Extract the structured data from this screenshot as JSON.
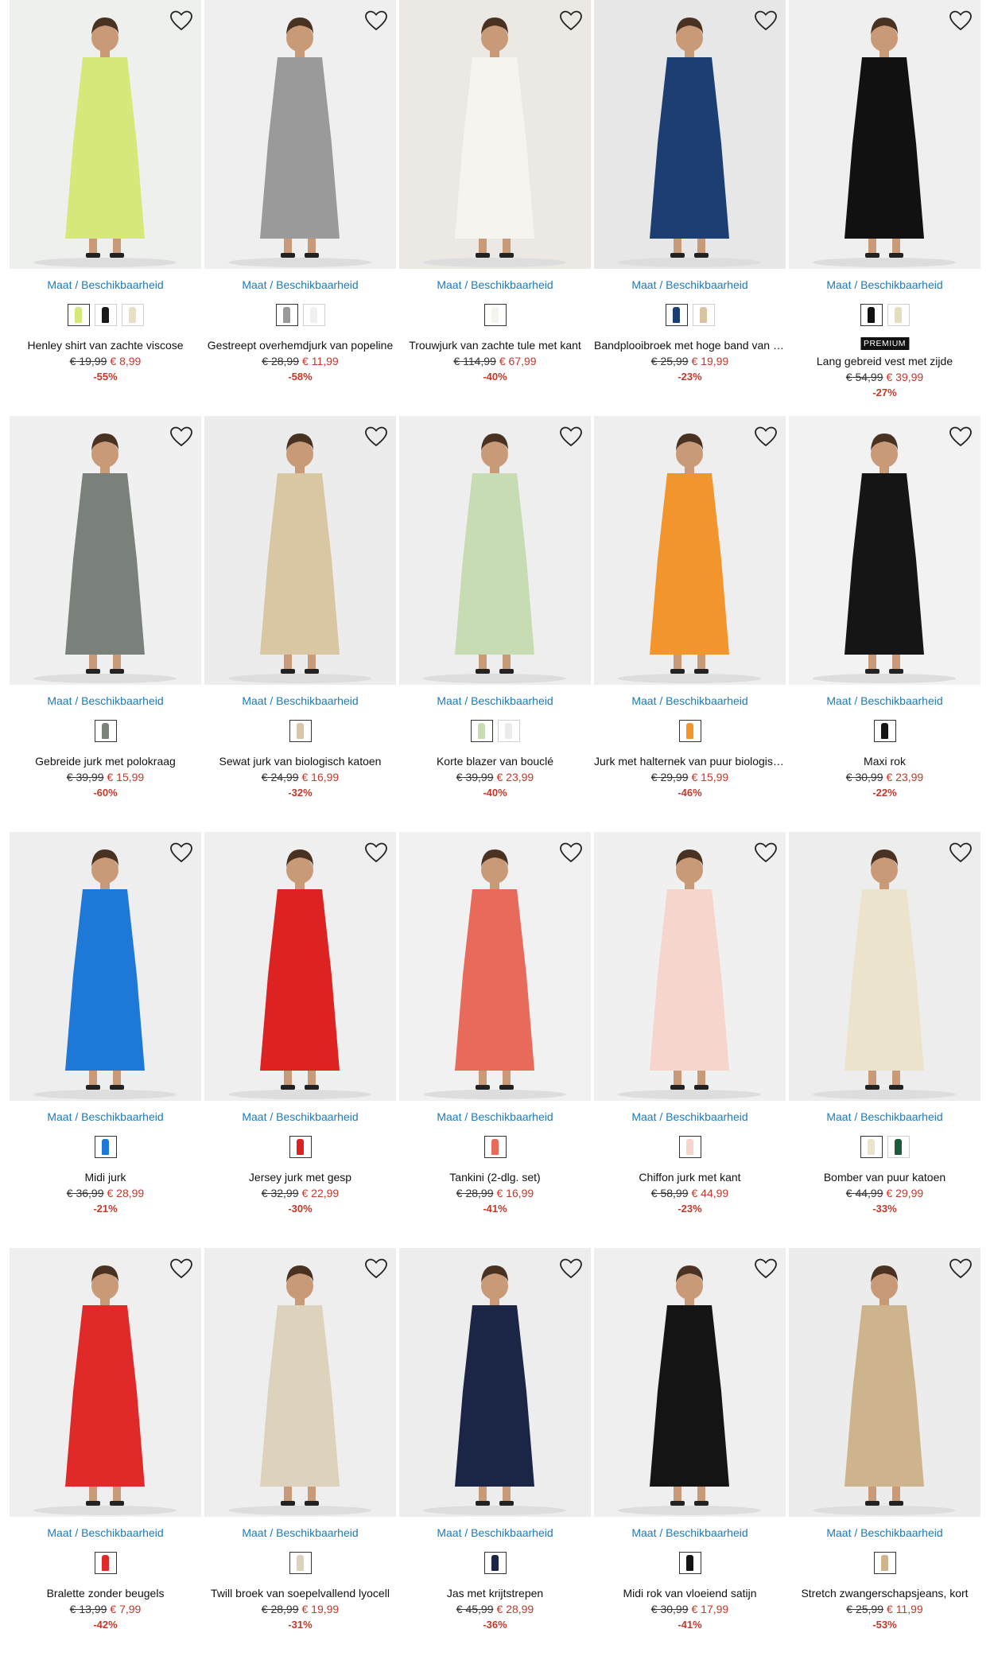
{
  "size_link_text": "Maat / Beschikbaarheid",
  "products": [
    {
      "name": "Henley shirt van zachte viscose",
      "old": "€ 19,99",
      "new": "€ 8,99",
      "disc": "-55%",
      "bg": "#eef0ee",
      "colors": [
        "#d7e87a",
        "#1a1a1a",
        "#e6e0c8"
      ],
      "badge": ""
    },
    {
      "name": "Gestreept overhemdjurk van popeline",
      "old": "€ 28,99",
      "new": "€ 11,99",
      "disc": "-58%",
      "bg": "#efefef",
      "colors": [
        "#9a9a9a",
        "#f0f0f0"
      ],
      "badge": ""
    },
    {
      "name": "Trouwjurk van zachte tule met kant",
      "old": "€ 114,99",
      "new": "€ 67,99",
      "disc": "-40%",
      "bg": "#ece9e4",
      "colors": [
        "#f6f4ef"
      ],
      "badge": ""
    },
    {
      "name": "Bandplooibroek met hoge band van crêpe",
      "old": "€ 25,99",
      "new": "€ 19,99",
      "disc": "-23%",
      "bg": "#e7e7e7",
      "colors": [
        "#1c3e73",
        "#d9c3a0"
      ],
      "badge": ""
    },
    {
      "name": "Lang gebreid vest met zijde",
      "old": "€ 54,99",
      "new": "€ 39,99",
      "disc": "-27%",
      "bg": "#efefef",
      "colors": [
        "#111111",
        "#e3dfbd"
      ],
      "badge": "PREMIUM"
    },
    {
      "name": "Gebreide jurk met polokraag",
      "old": "€ 39,99",
      "new": "€ 15,99",
      "disc": "-60%",
      "bg": "#f0f0f0",
      "colors": [
        "#7a807a"
      ],
      "badge": ""
    },
    {
      "name": "Sewat jurk van biologisch katoen",
      "old": "€ 24,99",
      "new": "€ 16,99",
      "disc": "-32%",
      "bg": "#ececec",
      "colors": [
        "#d9c7a4"
      ],
      "badge": ""
    },
    {
      "name": "Korte blazer van bouclé",
      "old": "€ 39,99",
      "new": "€ 23,99",
      "disc": "-40%",
      "bg": "#eeeeee",
      "colors": [
        "#c8dcb4",
        "#ebebeb"
      ],
      "badge": ""
    },
    {
      "name": "Jurk met halternek van puur biologisch katoen",
      "old": "€ 29,99",
      "new": "€ 15,99",
      "disc": "-46%",
      "bg": "#eeeeee",
      "colors": [
        "#f2952c"
      ],
      "badge": ""
    },
    {
      "name": "Maxi rok",
      "old": "€ 30,99",
      "new": "€ 23,99",
      "disc": "-22%",
      "bg": "#f2f2f2",
      "colors": [
        "#151515"
      ],
      "badge": ""
    },
    {
      "name": "Midi jurk",
      "old": "€ 36,99",
      "new": "€ 28,99",
      "disc": "-21%",
      "bg": "#eeeeee",
      "colors": [
        "#1e78d8"
      ],
      "badge": ""
    },
    {
      "name": "Jersey jurk met gesp",
      "old": "€ 32,99",
      "new": "€ 22,99",
      "disc": "-30%",
      "bg": "#efefef",
      "colors": [
        "#dd2222"
      ],
      "badge": ""
    },
    {
      "name": "Tankini (2-dlg. set)",
      "old": "€ 28,99",
      "new": "€ 16,99",
      "disc": "-41%",
      "bg": "#f1f1f1",
      "colors": [
        "#e86a5a"
      ],
      "badge": ""
    },
    {
      "name": "Chiffon jurk met kant",
      "old": "€ 58,99",
      "new": "€ 44,99",
      "disc": "-23%",
      "bg": "#f0f0f0",
      "colors": [
        "#f5d5cc"
      ],
      "badge": ""
    },
    {
      "name": "Bomber van puur katoen",
      "old": "€ 44,99",
      "new": "€ 29,99",
      "disc": "-33%",
      "bg": "#ededed",
      "colors": [
        "#ece3cc",
        "#1e5a3c"
      ],
      "badge": ""
    },
    {
      "name": "Bralette zonder beugels",
      "old": "€ 13,99",
      "new": "€ 7,99",
      "disc": "-42%",
      "bg": "#efefef",
      "colors": [
        "#e02a2a"
      ],
      "badge": ""
    },
    {
      "name": "Twill broek van soepelvallend lyocell",
      "old": "€ 28,99",
      "new": "€ 19,99",
      "disc": "-31%",
      "bg": "#eeeeee",
      "colors": [
        "#ddd3bd"
      ],
      "badge": ""
    },
    {
      "name": "Jas met krijtstrepen",
      "old": "€ 45,99",
      "new": "€ 28,99",
      "disc": "-36%",
      "bg": "#ededed",
      "colors": [
        "#1b2545"
      ],
      "badge": ""
    },
    {
      "name": "Midi rok van vloeiend satijn",
      "old": "€ 30,99",
      "new": "€ 17,99",
      "disc": "-41%",
      "bg": "#efefef",
      "colors": [
        "#141414"
      ],
      "badge": ""
    },
    {
      "name": "Stretch zwangerschapsjeans, kort",
      "old": "€ 25,99",
      "new": "€ 11,99",
      "disc": "-53%",
      "bg": "#ececec",
      "colors": [
        "#cdb48c"
      ],
      "badge": ""
    }
  ]
}
